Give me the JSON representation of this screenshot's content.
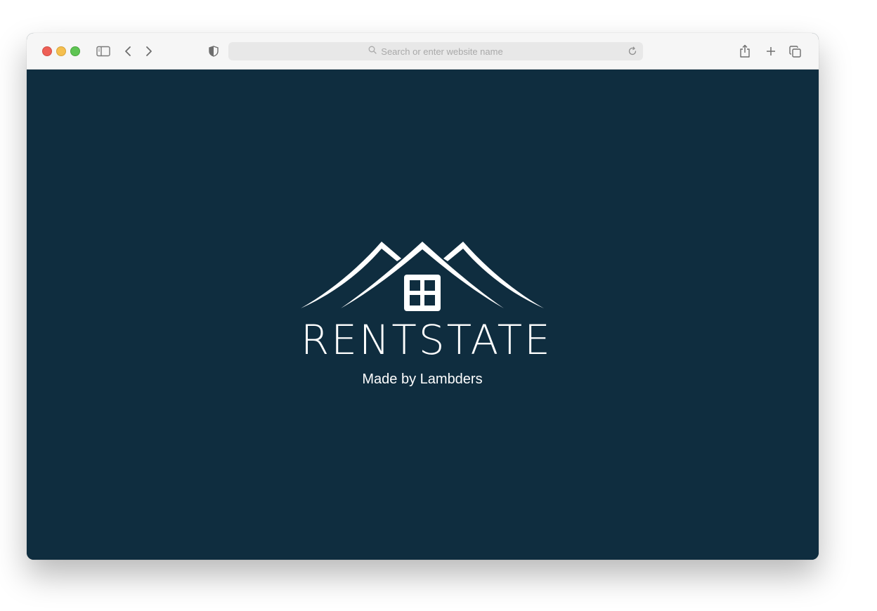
{
  "browser": {
    "address_placeholder": "Search or enter website name",
    "icons": {
      "sidebar": "sidebar-icon",
      "back": "chevron-left-icon",
      "forward": "chevron-right-icon",
      "privacy": "shield-icon",
      "search": "search-icon",
      "reload": "reload-icon",
      "share": "share-icon",
      "new_tab": "plus-icon",
      "tabs": "tabs-overview-icon"
    }
  },
  "page": {
    "brand": "RENTSTATE",
    "tagline": "Made by Lambders",
    "logo_icon": "house-roof-logo-icon"
  },
  "colors": {
    "background": "#0f2d3f",
    "brand_text": "#ffffff",
    "toolbar": "#f6f6f6"
  }
}
